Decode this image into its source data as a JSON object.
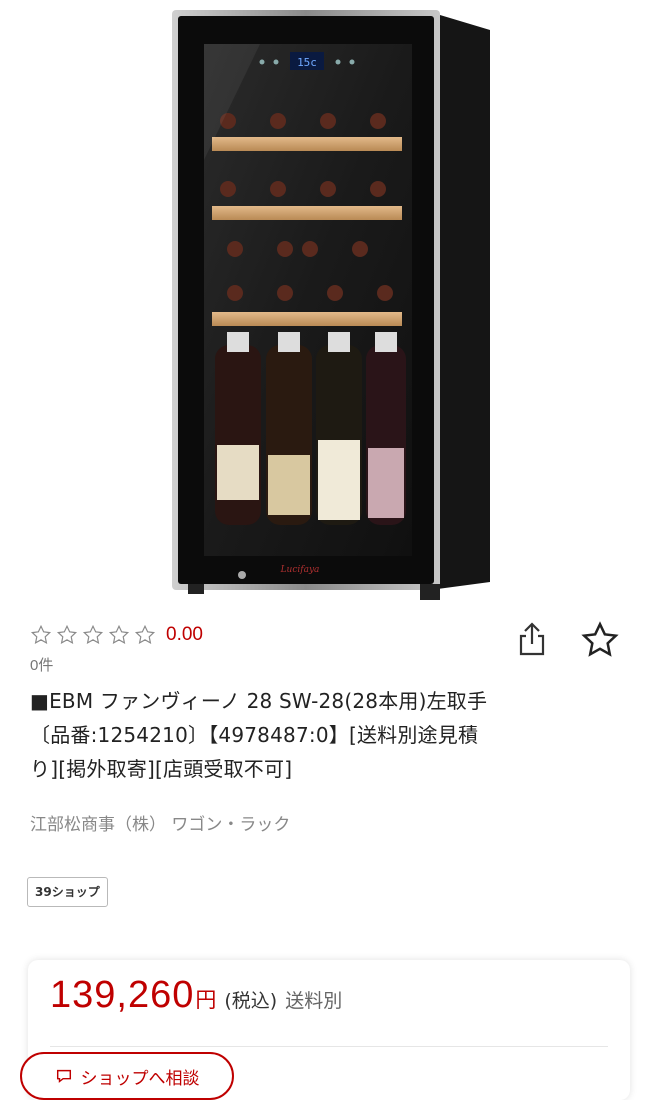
{
  "product": {
    "image_alt": "ワインセラー",
    "display_temp": "15c",
    "brand_mark": "Lucifaya",
    "rating": {
      "stars_filled": 0,
      "stars_total": 5,
      "value": "0.00",
      "review_count": "0件"
    },
    "title_lines": [
      "■EBM ファンヴィーノ 28 SW-28(28本用)左取手",
      "〔品番:1254210〕【4978487:0】[送料別途見積",
      "り][掲外取寄][店頭受取不可]"
    ],
    "category": "江部松商事（株） ワゴン・ラック",
    "shop_badge": "39ショップ"
  },
  "actions": {
    "share_icon": "share-icon",
    "favorite_icon": "star-outline-icon"
  },
  "price": {
    "amount": "139,260",
    "currency": "円",
    "tax": "(税込)",
    "shipping": "送料別",
    "consult_button": "ショップへ相談"
  },
  "colors": {
    "accent": "#bf0000",
    "muted": "#888888"
  }
}
